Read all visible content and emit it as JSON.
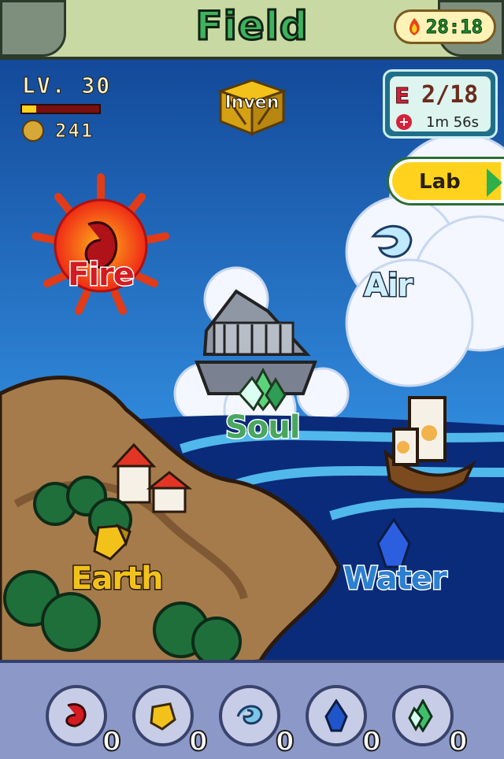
{
  "header": {
    "title": "Field",
    "timer": "28:18"
  },
  "player": {
    "level_label": "LV. 30",
    "xp_progress": 0.18,
    "coins": "241"
  },
  "inventory": {
    "label": "Inven"
  },
  "energy": {
    "icon_letter": "E",
    "count": "2/18",
    "refill_timer": "1m 56s",
    "plus_glyph": "+"
  },
  "lab": {
    "label": "Lab"
  },
  "locations": {
    "fire": "Fire",
    "air": "Air",
    "soul": "Soul",
    "earth": "Earth",
    "water": "Water"
  },
  "elements": [
    {
      "name": "fire",
      "count": "0",
      "color": "#d41b22"
    },
    {
      "name": "earth",
      "count": "0",
      "color": "#f2c21a"
    },
    {
      "name": "air",
      "count": "0",
      "color": "#7cc6e8"
    },
    {
      "name": "water",
      "count": "0",
      "color": "#1f55c8"
    },
    {
      "name": "soul",
      "count": "0",
      "color": "#3fbf6a"
    }
  ],
  "colors": {
    "fire": "#d41b22",
    "earth": "#f2c21a",
    "air": "#cfefff",
    "water": "#2c7fd0",
    "soul": "#4aa65f"
  }
}
